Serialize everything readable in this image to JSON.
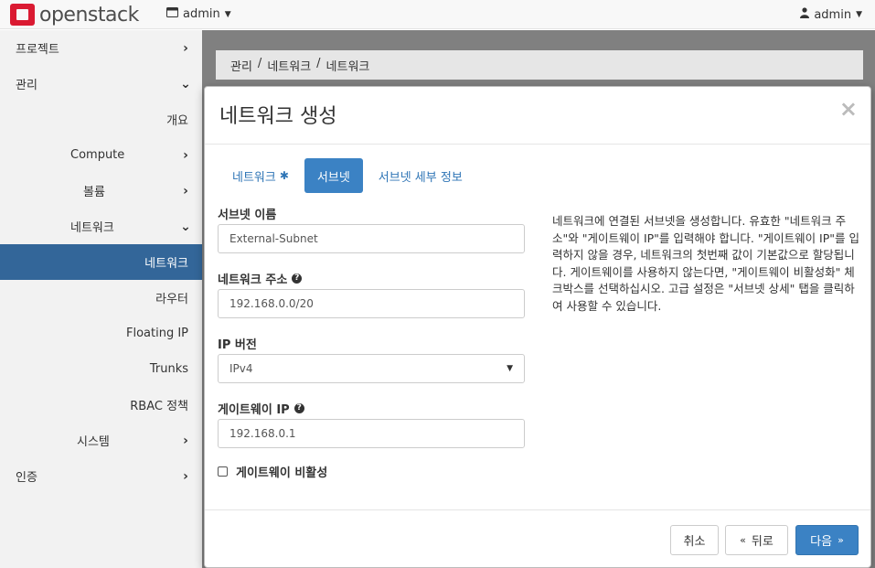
{
  "navbar": {
    "logo_text": "openstack",
    "project_picker": "admin",
    "user_menu": "admin"
  },
  "sidebar": {
    "items": [
      {
        "label": "프로젝트",
        "chevron": "right"
      },
      {
        "label": "관리",
        "chevron": "down"
      },
      {
        "label": "개요"
      },
      {
        "label": "Compute",
        "chevron": "right"
      },
      {
        "label": "볼륨",
        "chevron": "right"
      },
      {
        "label": "네트워크",
        "chevron": "down"
      },
      {
        "label": "네트워크",
        "active": true
      },
      {
        "label": "라우터"
      },
      {
        "label": "Floating IP"
      },
      {
        "label": "Trunks"
      },
      {
        "label": "RBAC 정책"
      },
      {
        "label": "시스템",
        "chevron": "right"
      },
      {
        "label": "인증",
        "chevron": "right"
      }
    ]
  },
  "breadcrumb": [
    "관리",
    "/",
    "네트워크",
    "/",
    "네트워크"
  ],
  "modal": {
    "title": "네트워크 생성",
    "close": "×",
    "tabs": [
      {
        "label": "네트워크",
        "required_mark": "✱"
      },
      {
        "label": "서브넷",
        "active": true
      },
      {
        "label": "서브넷 세부 정보"
      }
    ],
    "fields": {
      "subnet_name": {
        "label": "서브넷 이름",
        "value": "External-Subnet"
      },
      "network_address": {
        "label": "네트워크 주소",
        "value": "192.168.0.0/20"
      },
      "ip_version": {
        "label": "IP 버전",
        "value": "IPv4"
      },
      "gateway_ip": {
        "label": "게이트웨이 IP",
        "value": "192.168.0.1"
      },
      "disable_gateway": {
        "label": "게이트웨이 비활성",
        "checked": false
      }
    },
    "help_text": "네트워크에 연결된 서브넷을 생성합니다. 유효한 \"네트워크 주소\"와 \"게이트웨이 IP\"를 입력해야 합니다. \"게이트웨이 IP\"를 입력하지 않을 경우, 네트워크의 첫번째 값이 기본값으로 할당됩니다. 게이트웨이를 사용하지 않는다면, \"게이트웨이 비활성화\" 체크박스를 선택하십시오. 고급 설정은 \"서브넷 상세\" 탭을 클릭하여 사용할 수 있습니다.",
    "footer": {
      "cancel": "취소",
      "back": "뒤로",
      "back_icon": "«",
      "next": "다음",
      "next_icon": "»"
    }
  }
}
